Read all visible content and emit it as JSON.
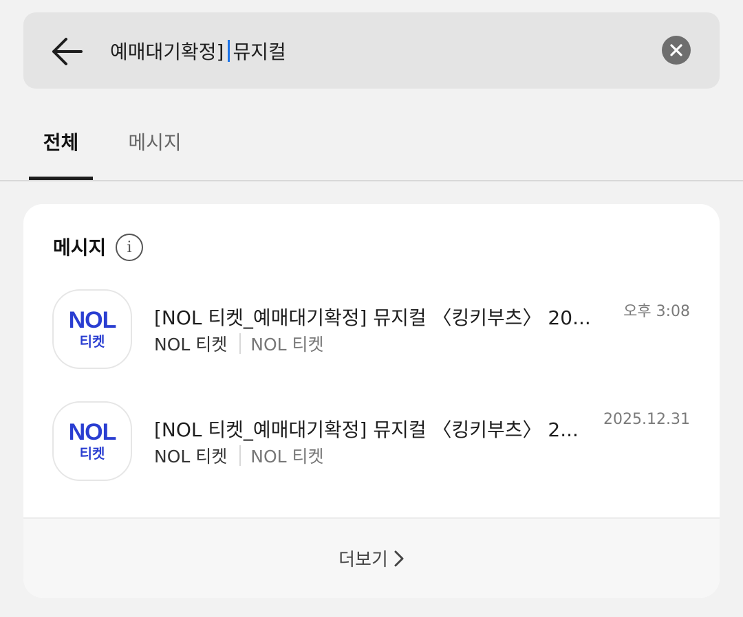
{
  "search": {
    "query_before_cursor": "예매대기확정]",
    "query_after_cursor": "뮤지컬"
  },
  "tabs": [
    {
      "label": "전체",
      "active": true
    },
    {
      "label": "메시지",
      "active": false
    }
  ],
  "section": {
    "title": "메시지"
  },
  "messages": [
    {
      "icon": {
        "logo_text": "NOL",
        "logo_sub": "티켓",
        "color": "#2a3ed1"
      },
      "title": "[NOL 티켓_예매대기확정] 뮤지컬 〈킹키부츠〉 20...",
      "sender": "NOL 티켓",
      "channel": "NOL 티켓",
      "time": "오후 3:08"
    },
    {
      "icon": {
        "logo_text": "NOL",
        "logo_sub": "티켓",
        "color": "#2a3ed1"
      },
      "title": "[NOL 티켓_예매대기확정] 뮤지컬 〈킹키부츠〉 2...",
      "sender": "NOL 티켓",
      "channel": "NOL 티켓",
      "time": "2025.12.31"
    }
  ],
  "more_label": "더보기",
  "icons": [
    "back-arrow-icon",
    "clear-icon",
    "info-icon",
    "chevron-right-icon"
  ]
}
